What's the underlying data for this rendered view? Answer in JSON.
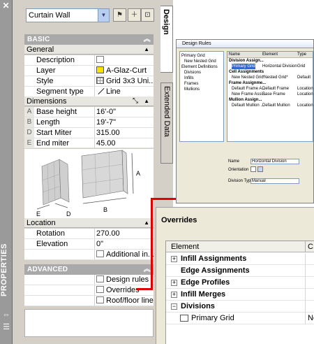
{
  "palette": {
    "title": "PROPERTIES",
    "style_value": "Curtain Wall",
    "tabs": {
      "design": "Design",
      "extended": "Extended Data"
    },
    "basic": {
      "header": "BASIC",
      "general_header": "General",
      "rows": [
        {
          "label": "Description",
          "value": "",
          "icon": "description-icon"
        },
        {
          "label": "Layer",
          "value": "A-Glaz-Curt",
          "icon": "yellow-color-swatch"
        },
        {
          "label": "Style",
          "value": "Grid 3x3 Uni...",
          "icon": "grid-icon"
        },
        {
          "label": "Segment type",
          "value": "Line",
          "icon": "line-segment-icon"
        }
      ],
      "dimensions_header": "Dimensions",
      "dimensions": [
        {
          "letter": "A",
          "label": "Base height",
          "value": "16'-0\""
        },
        {
          "letter": "B",
          "label": "Length",
          "value": "19'-7\""
        },
        {
          "letter": "D",
          "label": "Start Miter",
          "value": "315.00"
        },
        {
          "letter": "E",
          "label": "End miter",
          "value": "45.00"
        }
      ],
      "illustration_labels": {
        "a": "A",
        "b": "B",
        "d": "D",
        "e": "E"
      },
      "location_header": "Location",
      "location": [
        {
          "label": "Rotation",
          "value": "270.00"
        },
        {
          "label": "Elevation",
          "value": "0\""
        },
        {
          "label": "",
          "value": "Additional in..."
        }
      ]
    },
    "advanced": {
      "header": "ADVANCED",
      "rows": [
        {
          "value": "Design rules"
        },
        {
          "value": "Overrides"
        },
        {
          "value": "Roof/floor line"
        }
      ]
    }
  },
  "design_rules_window": {
    "title": "Design Rules",
    "tree": [
      "Primary Grid",
      "New Nested Grid",
      "Element Definitions",
      "Divisions",
      "Infills",
      "Frames",
      "Mullions"
    ],
    "columns": [
      "Name",
      "Element",
      "Type"
    ],
    "rows": [
      {
        "name": "Division Assign...",
        "element": "",
        "type": "",
        "group": true
      },
      {
        "name": "Primary Grid",
        "element": "Horizontal Division",
        "type": "Grid"
      },
      {
        "name": "Cell Assignments",
        "element": "",
        "type": "",
        "group": true
      },
      {
        "name": "New Nested Grid",
        "element": "*Nested Grid*",
        "type": "Default"
      },
      {
        "name": "Frame Assignme...",
        "element": "",
        "type": "",
        "group": true
      },
      {
        "name": "Default Frame A...",
        "element": "Default Frame",
        "type": "Location"
      },
      {
        "name": "New Frame Assi...",
        "element": "Base Frame",
        "type": "Location"
      },
      {
        "name": "Mullion Assign...",
        "element": "",
        "type": "",
        "group": true
      },
      {
        "name": "Default Mullion ...",
        "element": "Default Mullion",
        "type": "Location"
      }
    ],
    "fields": {
      "name_label": "Name",
      "name_value": "Horizontal Division",
      "orientation_label": "Orientation",
      "division_type_label": "Division Type",
      "division_type_value": "Manual"
    }
  },
  "overrides": {
    "title": "Overrides",
    "column_element": "Element",
    "column_second": "C",
    "rows": [
      {
        "label": "Infill Assignments",
        "expander": "+",
        "bold": true
      },
      {
        "label": "Edge Assignments",
        "expander": "",
        "bold": true
      },
      {
        "label": "Edge Profiles",
        "expander": "+",
        "bold": true
      },
      {
        "label": "Infill Merges",
        "expander": "+",
        "bold": true
      },
      {
        "label": "Divisions",
        "expander": "−",
        "bold": true
      },
      {
        "label": "Primary Grid",
        "expander": "",
        "bold": false,
        "second": "No"
      }
    ]
  },
  "colors": {
    "callout": "#e00000",
    "palette_bg": "#d4d0c8",
    "category_bg": "#a9a9a9"
  }
}
